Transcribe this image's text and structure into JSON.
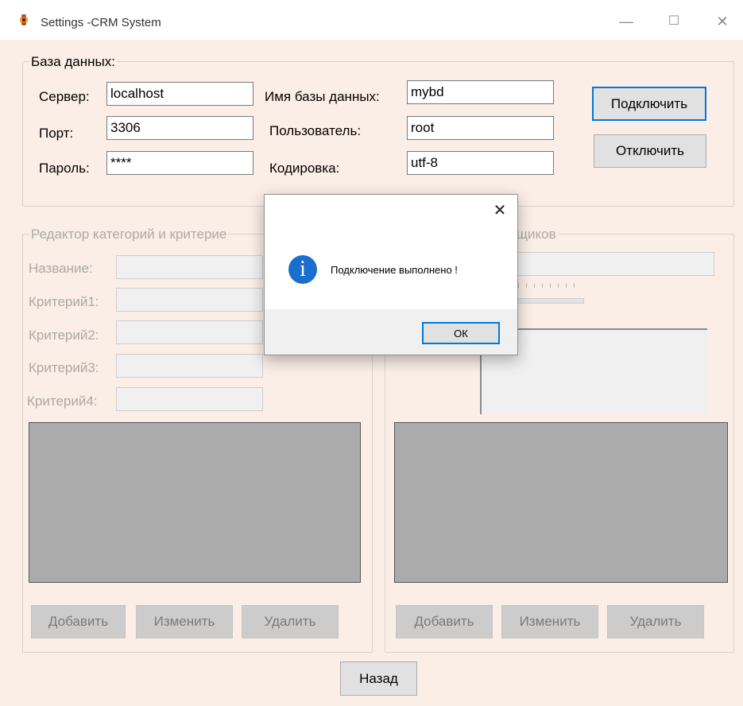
{
  "window": {
    "title": "Settings -CRM System",
    "minimize": "—",
    "maximize": "☐",
    "close": "✕"
  },
  "db": {
    "legend": "База данных:",
    "server_label": "Сервер:",
    "server_value": "localhost",
    "port_label": "Порт:",
    "port_value": "3306",
    "password_label": "Пароль:",
    "password_value": "****",
    "dbname_label": "Имя базы данных:",
    "dbname_value": "mybd",
    "user_label": "Пользователь:",
    "user_value": "root",
    "encoding_label": "Кодировка:",
    "encoding_value": "utf-8",
    "connect_label": "Подключить",
    "disconnect_label": "Отключить"
  },
  "editor": {
    "legend": "Редактор категорий и критерие",
    "name_label": "Название:",
    "crit1_label": "Критерий1:",
    "crit2_label": "Критерий2:",
    "crit3_label": "Критерий3:",
    "crit4_label": "Критерий4:",
    "add_label": "Добавить",
    "edit_label": "Изменить",
    "delete_label": "Удалить"
  },
  "suppliers": {
    "legend": "щиков",
    "add_label": "Добавить",
    "edit_label": "Изменить",
    "delete_label": "Удалить"
  },
  "back_label": "Назад",
  "dialog": {
    "close": "✕",
    "icon": "i",
    "message": "Подключение выполнено !",
    "ok_label": "ОК"
  },
  "colors": {
    "background": "#faeee6",
    "accent": "#0078d7",
    "info_icon": "#1a6fce",
    "grid": "#ababab"
  }
}
